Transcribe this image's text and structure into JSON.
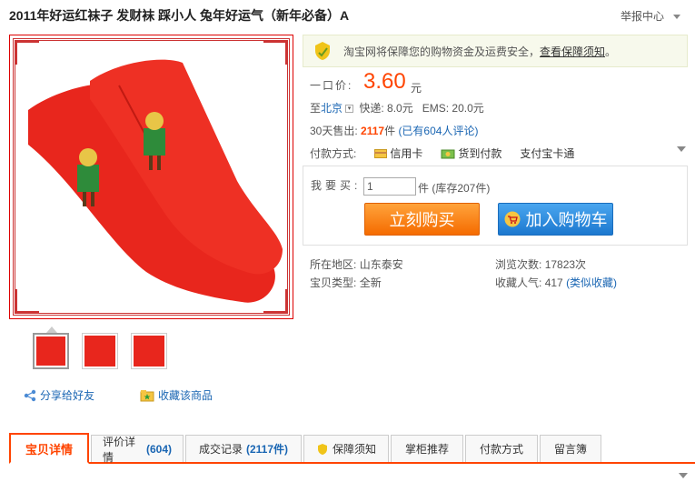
{
  "title": "2011年好运红袜子 发财袜 踩小人 兔年好运气（新年必备）A",
  "report_label": "举报中心",
  "guarantee": {
    "text": "淘宝网将保障您的购物资金及运费安全，",
    "link": "查看保障须知",
    "tail": "。"
  },
  "price": {
    "label": "一口价:",
    "value": "3.60",
    "unit": "元"
  },
  "shipping": {
    "prefix": "至",
    "city": "北京",
    "express": "快递: 8.0元",
    "ems": "EMS: 20.0元"
  },
  "sold": {
    "label": "30天售出:",
    "count": "2117",
    "unit": "件",
    "reviews": "(已有604人评论)"
  },
  "payment": {
    "label": "付款方式:",
    "options": [
      "信用卡",
      "货到付款",
      "支付宝卡通"
    ]
  },
  "buy": {
    "qty_label": "我要买:",
    "qty_value": "1",
    "stock": "件 (库存207件)",
    "buy_now": "立刻购买",
    "add_cart": "加入购物车"
  },
  "attributes": {
    "region_label": "所在地区:",
    "region": "山东泰安",
    "type_label": "宝贝类型:",
    "type": "全新",
    "views_label": "浏览次数:",
    "views": "17823次",
    "fav_label": "收藏人气:",
    "fav_count": "417",
    "fav_link": "(类似收藏)"
  },
  "actions": {
    "share": "分享给好友",
    "favorite": "收藏该商品"
  },
  "tabs": [
    {
      "label": "宝贝详情",
      "count": ""
    },
    {
      "label": "评价详情",
      "count": "(604)"
    },
    {
      "label": "成交记录",
      "count": "(2117件)"
    },
    {
      "label": "保障须知",
      "count": ""
    },
    {
      "label": "掌柜推荐",
      "count": ""
    },
    {
      "label": "付款方式",
      "count": ""
    },
    {
      "label": "留言簿",
      "count": ""
    }
  ],
  "colors": {
    "accent": "#ff4400",
    "link": "#1a66b3",
    "buy_button": "#f56b00",
    "cart_button": "#1c78cf",
    "sock": "#e8261d"
  }
}
